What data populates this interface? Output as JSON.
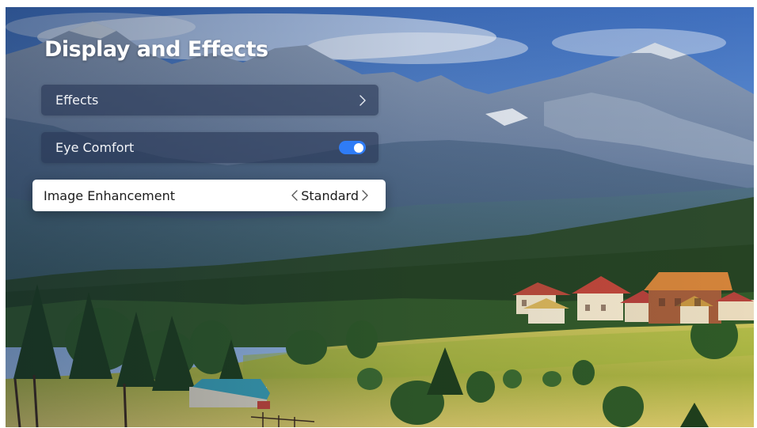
{
  "screen": {
    "title": "Display and Effects",
    "background": "mountain-valley-village-wallpaper"
  },
  "menu": {
    "items": [
      {
        "label": "Effects",
        "control": "chevron-right-icon"
      },
      {
        "label": "Eye Comfort",
        "control": "toggle",
        "toggle_on": true
      },
      {
        "label": "Image Enhancement",
        "value": "Standard",
        "focused": true
      }
    ]
  },
  "colors": {
    "accent": "#2f7cf6",
    "panel": "#28375580",
    "focused_row": "#ffffff"
  }
}
